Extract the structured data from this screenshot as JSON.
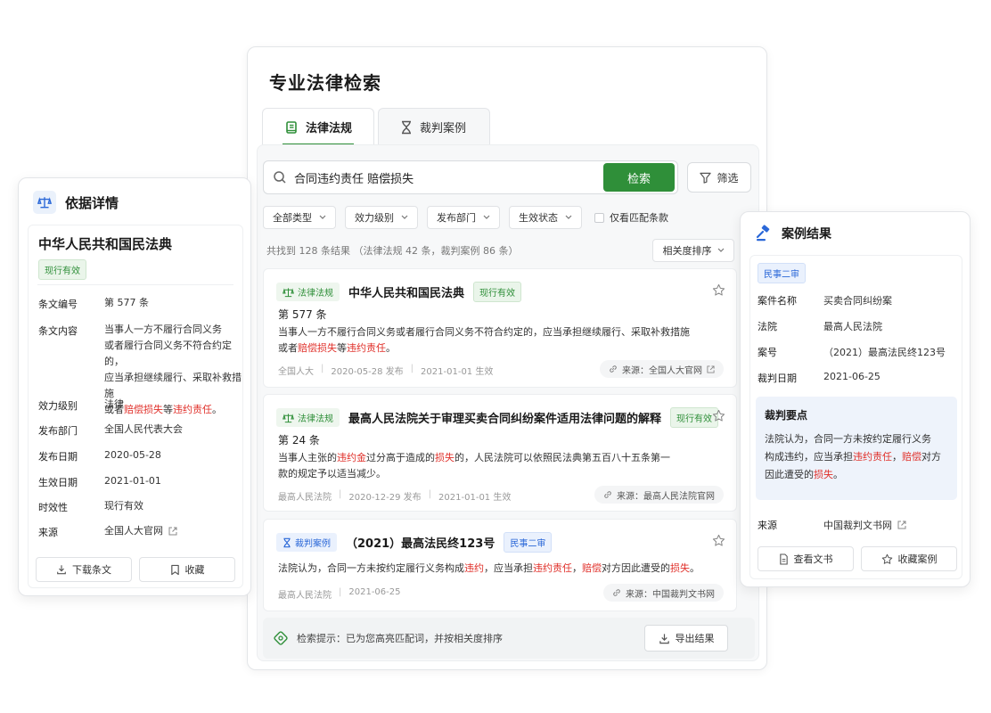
{
  "main": {
    "title": "专业法律检索",
    "tabs": [
      {
        "label": "法律法规",
        "active": true
      },
      {
        "label": "裁判案例",
        "active": false
      }
    ],
    "search": {
      "query": "合同违约责任 赔偿损失",
      "button": "检索",
      "filter": "筛选"
    },
    "dropdowns": [
      "全部类型",
      "效力级别",
      "发布部门",
      "生效状态"
    ],
    "checkbox_label": "仅看匹配条款",
    "summary": "共找到 128 条结果 （法律法规 42 条，裁判案例 86 条）",
    "sort": "相关度排序",
    "results": [
      {
        "type": "法律法规",
        "title": "中华人民共和国民法典",
        "status": "现行有效",
        "article": "第 577 条",
        "line1": "当事人一方不履行合同义务或者履行合同义务不符合约定的，应当承担继续履行、采取补救措施",
        "line2_pre": "或者",
        "line2_hl1": "赔偿损失",
        "line2_mid": "等",
        "line2_hl2": "违约责任",
        "line2_post": "。",
        "meta": [
          "全国人大",
          "2020-05-28 发布",
          "2021-01-01 生效"
        ],
        "source": "来源：全国人大官网"
      },
      {
        "type": "法律法规",
        "title": "最高人民法院关于审理买卖合同纠纷案件适用法律问题的解释",
        "status": "现行有效",
        "article": "第 24 条",
        "l1_pre": "当事人主张的",
        "l1_hl1": "违约金",
        "l1_mid": "过分高于造成的",
        "l1_hl2": "损失",
        "l1_post": "的，人民法院可以依照民法典第五百八十五条第一",
        "line2": "款的规定予以适当减少。",
        "meta": [
          "最高人民法院",
          "2020-12-29 发布",
          "2021-01-01 生效"
        ],
        "source": "来源：最高人民法院官网"
      },
      {
        "type": "裁判案例",
        "title": "（2021）最高法民终123号",
        "status": "民事二审",
        "t_pre": "法院认为，合同一方未按约定履行义务构成",
        "t_hl1": "违约",
        "t_mid1": "，应当承担",
        "t_hl2": "违约责任",
        "t_mid2": "，",
        "t_hl3": "赔偿",
        "t_mid3": "对方因此遭受的",
        "t_hl4": "损失",
        "t_post": "。",
        "meta": [
          "最高人民法院",
          "2021-06-25"
        ],
        "source": "来源：中国裁判文书网"
      }
    ],
    "tip": "检索提示：已为您高亮匹配词，并按相关度排序",
    "export": "导出结果"
  },
  "left": {
    "header": "依据详情",
    "law_title": "中华人民共和国民法典",
    "status": "现行有效",
    "fields": {
      "article_label": "条文编号",
      "article_value": "第 577 条",
      "content_label": "条文内容",
      "content_l1": "当事人一方不履行合同义务",
      "content_l2": "或者履行合同义务不符合约定的，",
      "content_l3": "应当承担继续履行、采取补救措施",
      "content_l4_pre": "或者",
      "content_l4_hl1": "赔偿损失",
      "content_l4_mid": "等",
      "content_l4_hl2": "违约责任",
      "content_l4_post": "。",
      "level_label": "效力级别",
      "level_value": "法律",
      "dept_label": "发布部门",
      "dept_value": "全国人民代表大会",
      "pub_label": "发布日期",
      "pub_value": "2020-05-28",
      "eff_label": "生效日期",
      "eff_value": "2021-01-01",
      "valid_label": "时效性",
      "valid_value": "现行有效",
      "source_label": "来源",
      "source_value": "全国人大官网"
    },
    "buttons": {
      "download": "下载条文",
      "favorite": "收藏"
    }
  },
  "right": {
    "header": "案例结果",
    "badge": "民事二审",
    "fields": {
      "name_label": "案件名称",
      "name_value": "买卖合同纠纷案",
      "court_label": "法院",
      "court_value": "最高人民法院",
      "case_label": "案号",
      "case_value": "（2021）最高法民终123号",
      "date_label": "裁判日期",
      "date_value": "2021-06-25",
      "source_label": "来源",
      "source_value": "中国裁判文书网"
    },
    "key": {
      "title": "裁判要点",
      "l1": "法院认为，合同一方未按约定履行义务",
      "l2_pre": "构成违约，应当承担",
      "l2_hl1": "违约责任",
      "l2_mid": "，",
      "l2_hl2": "赔偿",
      "l2_post": "对方",
      "l3_pre": "因此遭受的",
      "l3_hl": "损失",
      "l3_post": "。"
    },
    "buttons": {
      "view": "查看文书",
      "favorite": "收藏案例"
    }
  },
  "colors": {
    "accent_green": "#2f8f39",
    "highlight_red": "#e0302a",
    "accent_blue": "#2b68d8"
  },
  "icons": [
    "search-icon",
    "filter-icon",
    "chevron-down-icon",
    "star-icon",
    "scale-icon",
    "hourglass-icon",
    "book-icon",
    "gavel-icon",
    "link-icon",
    "external-link-icon",
    "download-icon",
    "bookmark-icon",
    "document-icon",
    "tip-icon"
  ]
}
